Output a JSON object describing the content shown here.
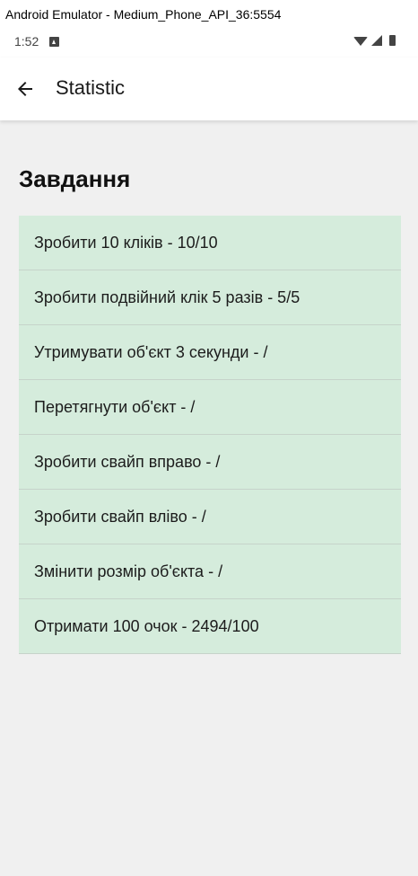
{
  "window": {
    "title": "Android Emulator - Medium_Phone_API_36:5554"
  },
  "status_bar": {
    "time": "1:52",
    "icons": [
      "notification-icon",
      "wifi-icon",
      "signal-icon",
      "battery-icon"
    ]
  },
  "app_bar": {
    "back_icon": "arrow-left-icon",
    "title": "Statistic"
  },
  "main": {
    "section_title": "Завдання",
    "tasks": [
      {
        "label": "Зробити 10 кліків - 10/10"
      },
      {
        "label": "Зробити подвійний клік 5 разів - 5/5"
      },
      {
        "label": "Утримувати об'єкт 3 секунди - /"
      },
      {
        "label": "Перетягнути об'єкт - /"
      },
      {
        "label": "Зробити свайп вправо - /"
      },
      {
        "label": "Зробити свайп вліво - /"
      },
      {
        "label": "Змінити розмір об'єкта - /"
      },
      {
        "label": "Отримати 100 очок - 2494/100"
      }
    ]
  },
  "colors": {
    "background": "#f0f0f0",
    "task_background": "#d5ecdc",
    "app_bar": "#ffffff"
  }
}
